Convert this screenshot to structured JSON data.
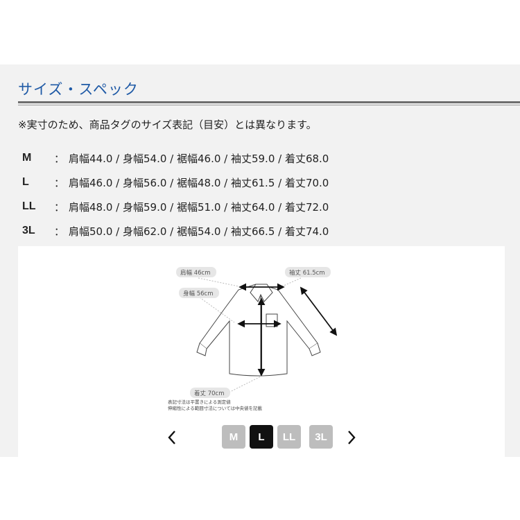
{
  "section": {
    "title": "サイズ・スペック",
    "note": "※実寸のため、商品タグのサイズ表記（目安）とは異なります。"
  },
  "specs": [
    {
      "size": "M",
      "sep": "：",
      "values": "肩幅44.0 / 身幅54.0 / 裾幅46.0 / 袖丈59.0 / 着丈68.0"
    },
    {
      "size": "L",
      "sep": "：",
      "values": "肩幅46.0 / 身幅56.0 / 裾幅48.0 / 袖丈61.5 / 着丈70.0"
    },
    {
      "size": "LL",
      "sep": "：",
      "values": "肩幅48.0 / 身幅59.0 / 裾幅51.0 / 袖丈64.0 / 着丈72.0"
    },
    {
      "size": "3L",
      "sep": "：",
      "values": "肩幅50.0 / 身幅62.0 / 裾幅54.0 / 袖丈66.5 / 着丈74.0"
    }
  ],
  "diagram": {
    "shoulder_label": "肩幅 46cm",
    "chest_label": "身幅 56cm",
    "sleeve_label": "袖丈 61.5cm",
    "length_label": "着丈 70cm",
    "footnote_1": "表記寸法は平置きによる測定値",
    "footnote_2": "伸縮性による範囲寸法については中央値を記載"
  },
  "carousel": {
    "prev_icon": "chevron-left-icon",
    "next_icon": "chevron-right-icon",
    "tabs": [
      "M",
      "L",
      "LL",
      "3L"
    ],
    "selected": "L"
  },
  "colors": {
    "title": "#1f5aa6",
    "panel": "#f2f2f2",
    "tab_active": "#111111",
    "tab_inactive": "#bdbdbd"
  }
}
